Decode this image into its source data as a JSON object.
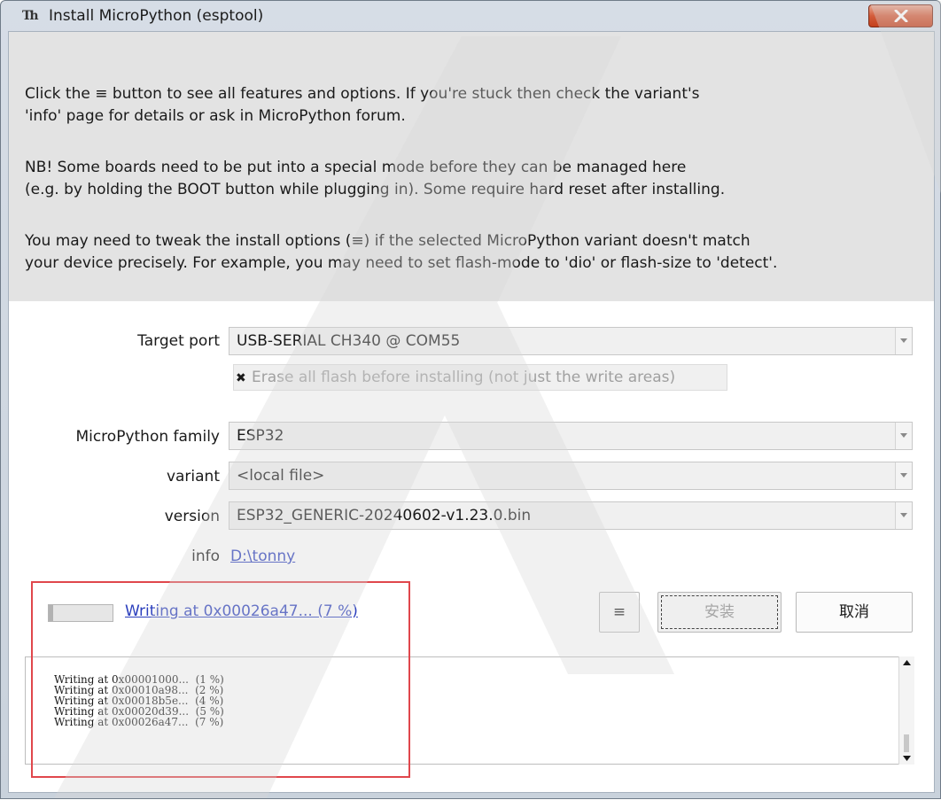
{
  "window": {
    "title": "Install MicroPython (esptool)",
    "icon": "thonny-app-icon",
    "close_icon": "close-icon"
  },
  "intro": {
    "p1_line1": "Click the ≡ button to see all features and options. If you're stuck then check the variant's",
    "p1_line2": "'info' page for details or ask in MicroPython forum.",
    "p2_line1": "NB! Some boards need to be put into a special mode before they can be managed here",
    "p2_line2": "(e.g. by holding the BOOT button while plugging in). Some require hard reset after installing.",
    "p3_line1": "You may need to tweak the install options (≡) if the selected MicroPython variant doesn't match",
    "p3_line2": "your device precisely. For example, you may need to set flash-mode to 'dio' or flash-size to 'detect'."
  },
  "form": {
    "target_port_label": "Target port",
    "target_port_value": "USB-SERIAL CH340 @ COM55",
    "erase_mark": "✖",
    "erase_label": "Erase all flash before installing (not just the write areas)",
    "family_label": "MicroPython family",
    "family_value": "ESP32",
    "variant_label": "variant",
    "variant_value": "<local file>",
    "version_label": "version",
    "version_value": "ESP32_GENERIC-20240602-v1.23.0.bin",
    "info_label": "info",
    "info_value": "D:\\tonny"
  },
  "status": {
    "progress_percent": 7,
    "text": "Writing at 0x00026a47... (7 %)"
  },
  "buttons": {
    "menu_label": "≡",
    "install_label": "安装",
    "cancel_label": "取消"
  },
  "log": {
    "lines": [
      "Writing at 0x00001000...  (1 %)",
      "Writing at 0x00010a98...  (2 %)",
      "Writing at 0x00018b5e...  (4 %)",
      "Writing at 0x00020d39...  (5 %)",
      "Writing at 0x00026a47...  (7 %)"
    ]
  },
  "colors": {
    "link": "#2b3fbd",
    "highlight_border": "#e0474c",
    "intro_bg": "#e3e3e3"
  }
}
